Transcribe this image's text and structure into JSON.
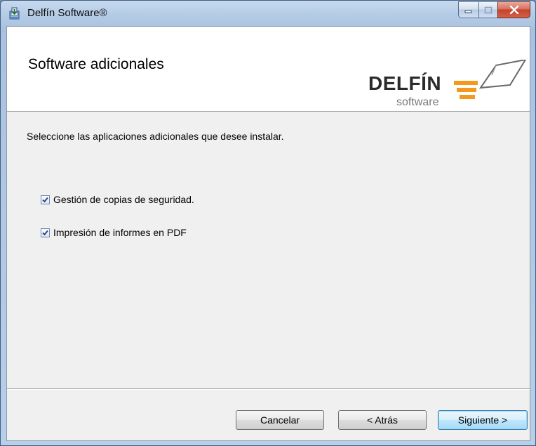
{
  "window": {
    "title": "Delfín Software®"
  },
  "banner": {
    "title": "Software adicionales",
    "logo_text": "DELFÍN",
    "logo_subtext": "software"
  },
  "content": {
    "instruction": "Seleccione las aplicaciones adicionales que desee instalar.",
    "options": [
      {
        "label": "Gestión de copias de seguridad.",
        "checked": true
      },
      {
        "label": "Impresión de informes en PDF",
        "checked": true
      }
    ]
  },
  "footer": {
    "cancel_label": "Cancelar",
    "back_label": "< Atrás",
    "next_label": "Siguiente >"
  },
  "colors": {
    "logo_orange": "#f39a1e",
    "logo_dark": "#2b2b2b",
    "default_button_border": "#3c7fb1"
  }
}
